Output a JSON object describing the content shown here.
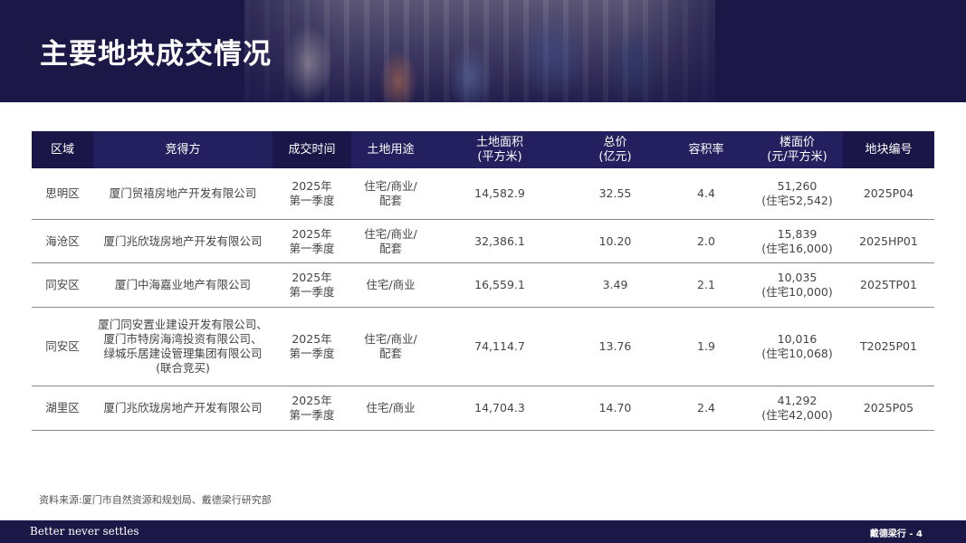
{
  "header": {
    "title": "主要地块成交情况"
  },
  "table": {
    "columns": [
      "区域",
      "竞得方",
      "成交时间",
      "土地用途",
      "土地面积\n(平方米)",
      "总价\n(亿元)",
      "容积率",
      "楼面价\n(元/平方米)",
      "地块编号"
    ],
    "rows": [
      [
        "思明区",
        "厦门贸禧房地产开发有限公司",
        "2025年\n第一季度",
        "住宅/商业/\n配套",
        "14,582.9",
        "32.55",
        "4.4",
        "51,260\n(住宅52,542)",
        "2025P04"
      ],
      [
        "海沧区",
        "厦门兆欣珑房地产开发有限公司",
        "2025年\n第一季度",
        "住宅/商业/\n配套",
        "32,386.1",
        "10.20",
        "2.0",
        "15,839\n(住宅16,000)",
        "2025HP01"
      ],
      [
        "同安区",
        "厦门中海嘉业地产有限公司",
        "2025年\n第一季度",
        "住宅/商业",
        "16,559.1",
        "3.49",
        "2.1",
        "10,035\n(住宅10,000)",
        "2025TP01"
      ],
      [
        "同安区",
        "厦门同安置业建设开发有限公司、\n厦门市特房海湾投资有限公司、\n绿城乐居建设管理集团有限公司\n(联合竞买)",
        "2025年\n第一季度",
        "住宅/商业/\n配套",
        "74,114.7",
        "13.76",
        "1.9",
        "10,016\n(住宅10,068)",
        "T2025P01"
      ],
      [
        "湖里区",
        "厦门兆欣珑房地产开发有限公司",
        "2025年\n第一季度",
        "住宅/商业",
        "14,704.3",
        "14.70",
        "2.4",
        "41,292\n(住宅42,000)",
        "2025P05"
      ]
    ]
  },
  "source": "资料来源:厦门市自然资源和规划局、戴德梁行研究部",
  "footer": {
    "tagline": "Better never settles",
    "brand": "戴德梁行 - 4"
  },
  "colors": {
    "navy": "#1b1848",
    "header_cell": "#241f5e",
    "header_cell_dark": "#1a1748"
  }
}
